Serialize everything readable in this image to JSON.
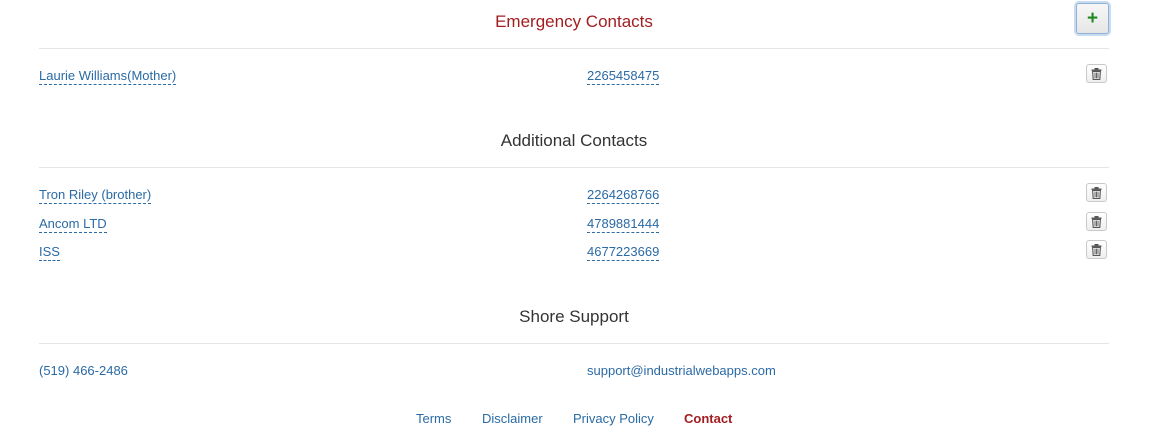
{
  "emergency": {
    "title": "Emergency Contacts",
    "add_label": "+",
    "contacts": [
      {
        "name": "Laurie Williams(Mother)",
        "phone": "2265458475"
      }
    ]
  },
  "additional": {
    "title": "Additional Contacts",
    "contacts": [
      {
        "name": "Tron Riley (brother)",
        "phone": "2264268766"
      },
      {
        "name": "Ancom LTD",
        "phone": "4789881444"
      },
      {
        "name": "ISS",
        "phone": "4677223669"
      }
    ]
  },
  "shore": {
    "title": "Shore Support",
    "phone": "(519) 466-2486",
    "email": "support@industrialwebapps.com"
  },
  "footer": {
    "links": [
      "Terms",
      "Disclaimer",
      "Privacy Policy",
      "Contact"
    ],
    "active": "Contact"
  },
  "colors": {
    "accent_red": "#a21d21",
    "link_blue": "#2a6aa5",
    "add_green": "#1e8a1e"
  },
  "icons": {
    "add": "plus-icon",
    "delete": "trash-icon"
  }
}
